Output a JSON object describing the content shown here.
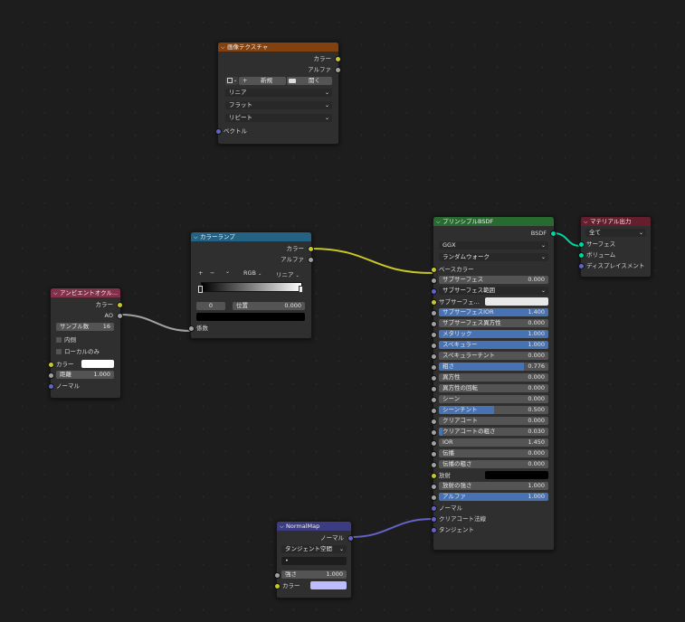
{
  "nodes": {
    "image_texture": {
      "title": "画像テクスチャ",
      "outputs": [
        "カラー",
        "アルファ"
      ],
      "new_label": "新規",
      "open_label": "開く",
      "interpolation": "リニア",
      "projection": "フラット",
      "extension": "リピート",
      "input_vector": "ベクトル",
      "header_color": "#83410f"
    },
    "color_ramp": {
      "title": "カラーランプ",
      "outputs": [
        "カラー",
        "アルファ"
      ],
      "plus": "+",
      "minus": "−",
      "mode": "RGB",
      "interp": "リニア",
      "index": "0",
      "pos_label": "位置",
      "pos_value": "0.000",
      "input_factor": "係数",
      "header_color": "#246283"
    },
    "ao": {
      "title": "アンビエントオクル...",
      "outputs": [
        "カラー",
        "AO"
      ],
      "samples_label": "サンプル数",
      "samples_value": "16",
      "inside": "内側",
      "only_local": "ローカルのみ",
      "color_label": "カラー",
      "distance_label": "距離",
      "distance_value": "1.000",
      "normal_label": "ノーマル",
      "header_color": "#83314a"
    },
    "principled": {
      "title": "プリンシプルBSDF",
      "output": "BSDF",
      "distribution": "GGX",
      "subsurface_method": "ランダムウォーク",
      "base_color": "ベースカラー",
      "fields": [
        {
          "label": "サブサーフェス",
          "value": "0.000",
          "fill": 0
        },
        {
          "label": "サブサーフェス範囲",
          "value": "",
          "fill": 0,
          "dropdown": true
        },
        {
          "label": "サブサーフェ...",
          "value": "",
          "fill": 0,
          "swatch": "#e8e8e8"
        },
        {
          "label": "サブサーフェスIOR",
          "value": "1.400",
          "fill": 1
        },
        {
          "label": "サブサーフェス異方性",
          "value": "0.000",
          "fill": 0
        },
        {
          "label": "メタリック",
          "value": "1.000",
          "fill": 1
        },
        {
          "label": "スペキュラー",
          "value": "1.000",
          "fill": 1
        },
        {
          "label": "スペキュラーチント",
          "value": "0.000",
          "fill": 0
        },
        {
          "label": "粗さ",
          "value": "0.776",
          "fill": 0.776
        },
        {
          "label": "異方性",
          "value": "0.000",
          "fill": 0
        },
        {
          "label": "異方性の回転",
          "value": "0.000",
          "fill": 0
        },
        {
          "label": "シーン",
          "value": "0.000",
          "fill": 0
        },
        {
          "label": "シーンチント",
          "value": "0.500",
          "fill": 0.5
        },
        {
          "label": "クリアコート",
          "value": "0.000",
          "fill": 0
        },
        {
          "label": "クリアコートの粗さ",
          "value": "0.030",
          "fill": 0.03
        },
        {
          "label": "IOR",
          "value": "1.450",
          "fill": 0
        },
        {
          "label": "伝播",
          "value": "0.000",
          "fill": 0
        },
        {
          "label": "伝播の粗さ",
          "value": "0.000",
          "fill": 0
        },
        {
          "label": "放射",
          "value": "",
          "fill": 0,
          "swatch": "#000000"
        },
        {
          "label": "放射の強さ",
          "value": "1.000",
          "fill": 0
        },
        {
          "label": "アルファ",
          "value": "1.000",
          "fill": 1
        }
      ],
      "normal": "ノーマル",
      "clearcoat_normal": "クリアコート法線",
      "tangent": "タンジェント",
      "header_color": "#276b31"
    },
    "material_output": {
      "title": "マテリアル出力",
      "target": "全て",
      "inputs": [
        "サーフェス",
        "ボリューム",
        "ディスプレイスメント"
      ],
      "header_color": "#641e2d"
    },
    "normal_map": {
      "title": "NormalMap",
      "output": "ノーマル",
      "space": "タンジェント空間",
      "uv": "•",
      "strength_label": "強さ",
      "strength_value": "1.000",
      "color_label": "カラー",
      "header_color": "#3c3c83"
    }
  }
}
